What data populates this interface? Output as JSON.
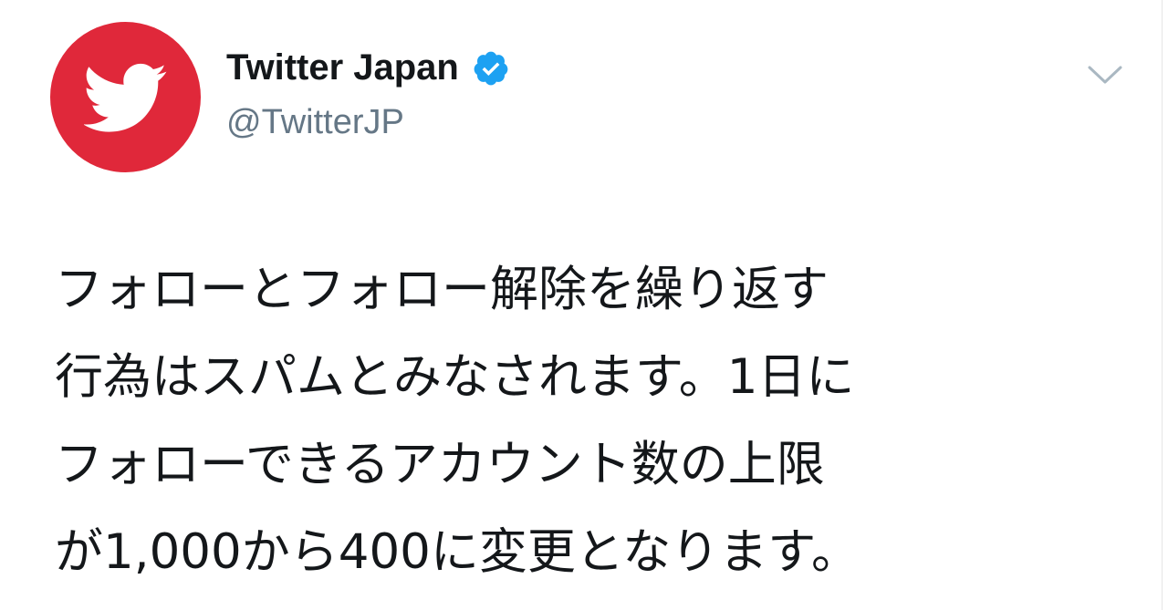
{
  "account": {
    "display_name": "Twitter Japan",
    "handle": "@TwitterJP",
    "verified": true,
    "avatar_color": "#e0283a",
    "avatar_icon": "twitter-bird-icon"
  },
  "tweet": {
    "lines": [
      "フォローとフォロー解除を繰り返す",
      "行為はスパムとみなされます。1日に",
      "フォローできるアカウント数の上限",
      "が1,000から400に変更となります。"
    ]
  },
  "colors": {
    "verified": "#1da1f2",
    "handle": "#657786",
    "text": "#14171a",
    "chevron": "#aab8c2"
  },
  "icons": {
    "menu": "chevron-down-icon",
    "badge": "verified-badge-icon"
  }
}
